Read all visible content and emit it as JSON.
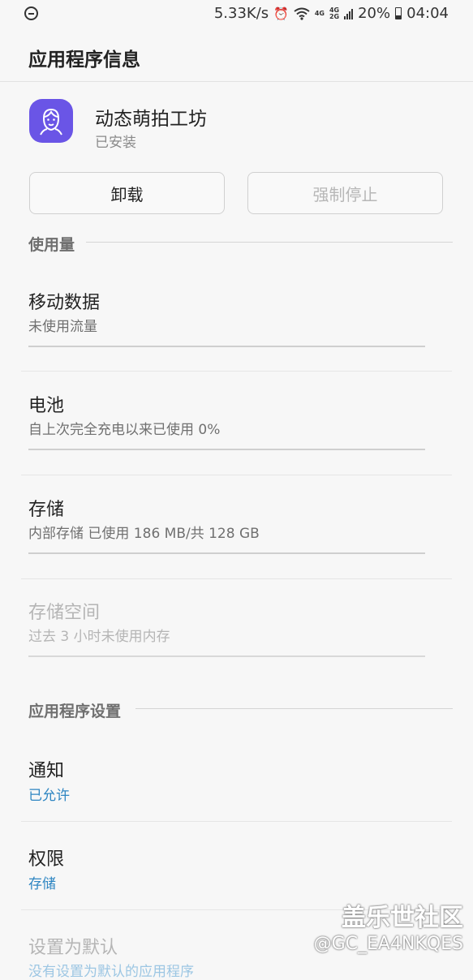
{
  "status_bar": {
    "speed": "5.33K/s",
    "network_top": "4G",
    "network_bottom": "2G",
    "battery": "20%",
    "time": "04:04"
  },
  "header": {
    "title": "应用程序信息"
  },
  "app": {
    "name": "动态萌拍工坊",
    "status": "已安装",
    "icon_color": "#6a55e6"
  },
  "buttons": {
    "uninstall": "卸载",
    "force_stop": "强制停止"
  },
  "usage": {
    "heading": "使用量",
    "mobile_data": {
      "title": "移动数据",
      "subtitle": "未使用流量"
    },
    "battery": {
      "title": "电池",
      "subtitle": "自上次完全充电以来已使用 0%"
    },
    "storage": {
      "title": "存储",
      "subtitle": "内部存储 已使用 186 MB/共 128 GB"
    },
    "memory": {
      "title": "存储空间",
      "subtitle": "过去 3 小时未使用内存"
    }
  },
  "settings": {
    "heading": "应用程序设置",
    "notifications": {
      "title": "通知",
      "subtitle": "已允许"
    },
    "permissions": {
      "title": "权限",
      "subtitle": "存储"
    },
    "defaults": {
      "title": "设置为默认",
      "subtitle": "没有设置为默认的应用程序"
    }
  },
  "watermark": {
    "brand": "盖乐世社区",
    "user": "@GC_EA4NKQES"
  },
  "colors": {
    "accent": "#2f86c2",
    "disabled": "#b5b5b5"
  }
}
